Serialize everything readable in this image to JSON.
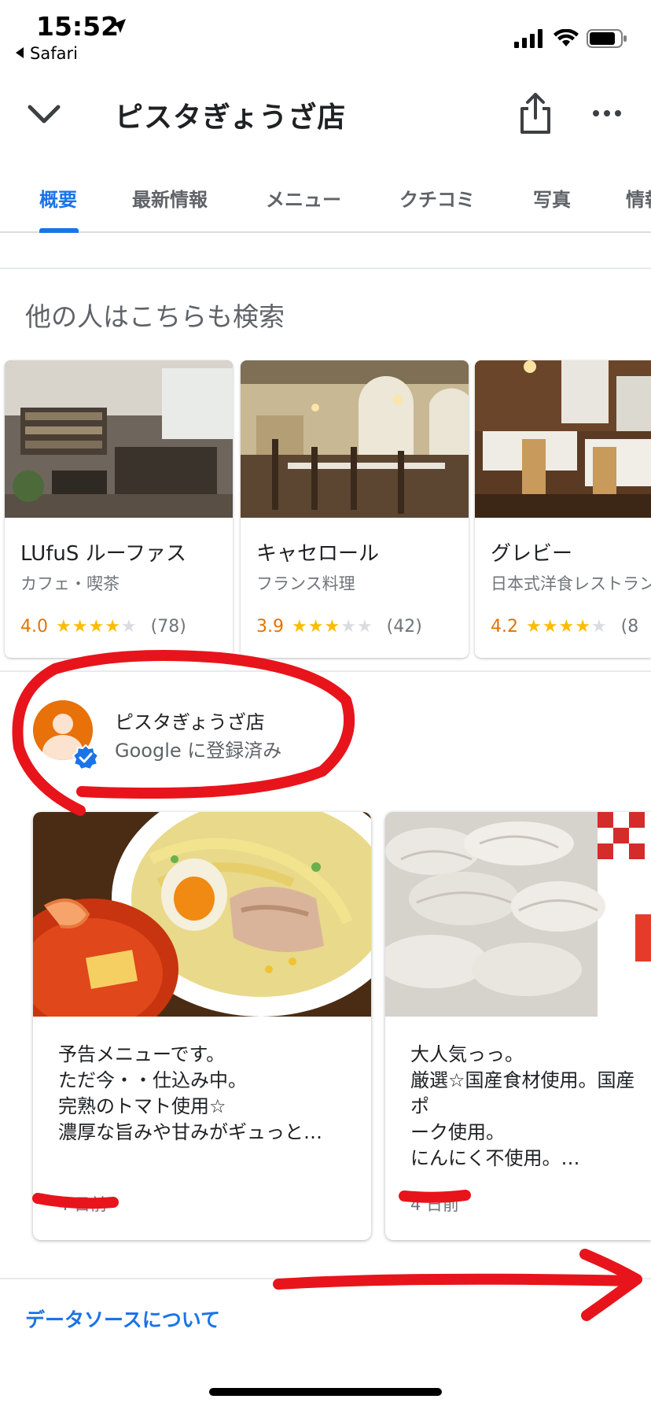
{
  "status_bar": {
    "time": "15:52",
    "back_app": "Safari"
  },
  "header": {
    "title": "ピスタぎょうざ店",
    "icons": [
      "chevron-down-icon",
      "share-icon",
      "more-icon"
    ]
  },
  "tabs": [
    {
      "label": "概要",
      "active": true
    },
    {
      "label": "最新情報",
      "active": false
    },
    {
      "label": "メニュー",
      "active": false
    },
    {
      "label": "クチコミ",
      "active": false
    },
    {
      "label": "写真",
      "active": false
    },
    {
      "label": "情報",
      "active": false
    }
  ],
  "related": {
    "title": "他の人はこちらも検索",
    "cards": [
      {
        "name": "LUfuS ルーファス",
        "category": "カフェ・喫茶",
        "rating": "4.0",
        "stars_filled": 4,
        "count": "(78)"
      },
      {
        "name": "キャセロール",
        "category": "フランス料理",
        "rating": "3.9",
        "stars_filled": 3,
        "count": "(42)"
      },
      {
        "name": "グレビー",
        "category": "日本式洋食レストラン",
        "rating": "4.2",
        "stars_filled": 4,
        "count": "(8"
      }
    ]
  },
  "owner": {
    "name": "ピスタぎょうざ店",
    "subtitle": "Google に登録済み"
  },
  "posts": [
    {
      "text": "予告メニューです。\nただ今・・仕込み中。\n完熟のトマト使用☆\n濃厚な旨みや甘みがギュっと…",
      "date": "4 日前"
    },
    {
      "text": "大人気っっ。\n厳選☆国産食材使用。国産ポ\nーク使用。\nにんにく不使用。…",
      "date": "4 日前"
    }
  ],
  "footer": {
    "link": "データソースについて"
  },
  "colors": {
    "accent": "#1a73e8",
    "rating": "#e37400",
    "star": "#fbbc04",
    "annotation": "#e8141c"
  }
}
